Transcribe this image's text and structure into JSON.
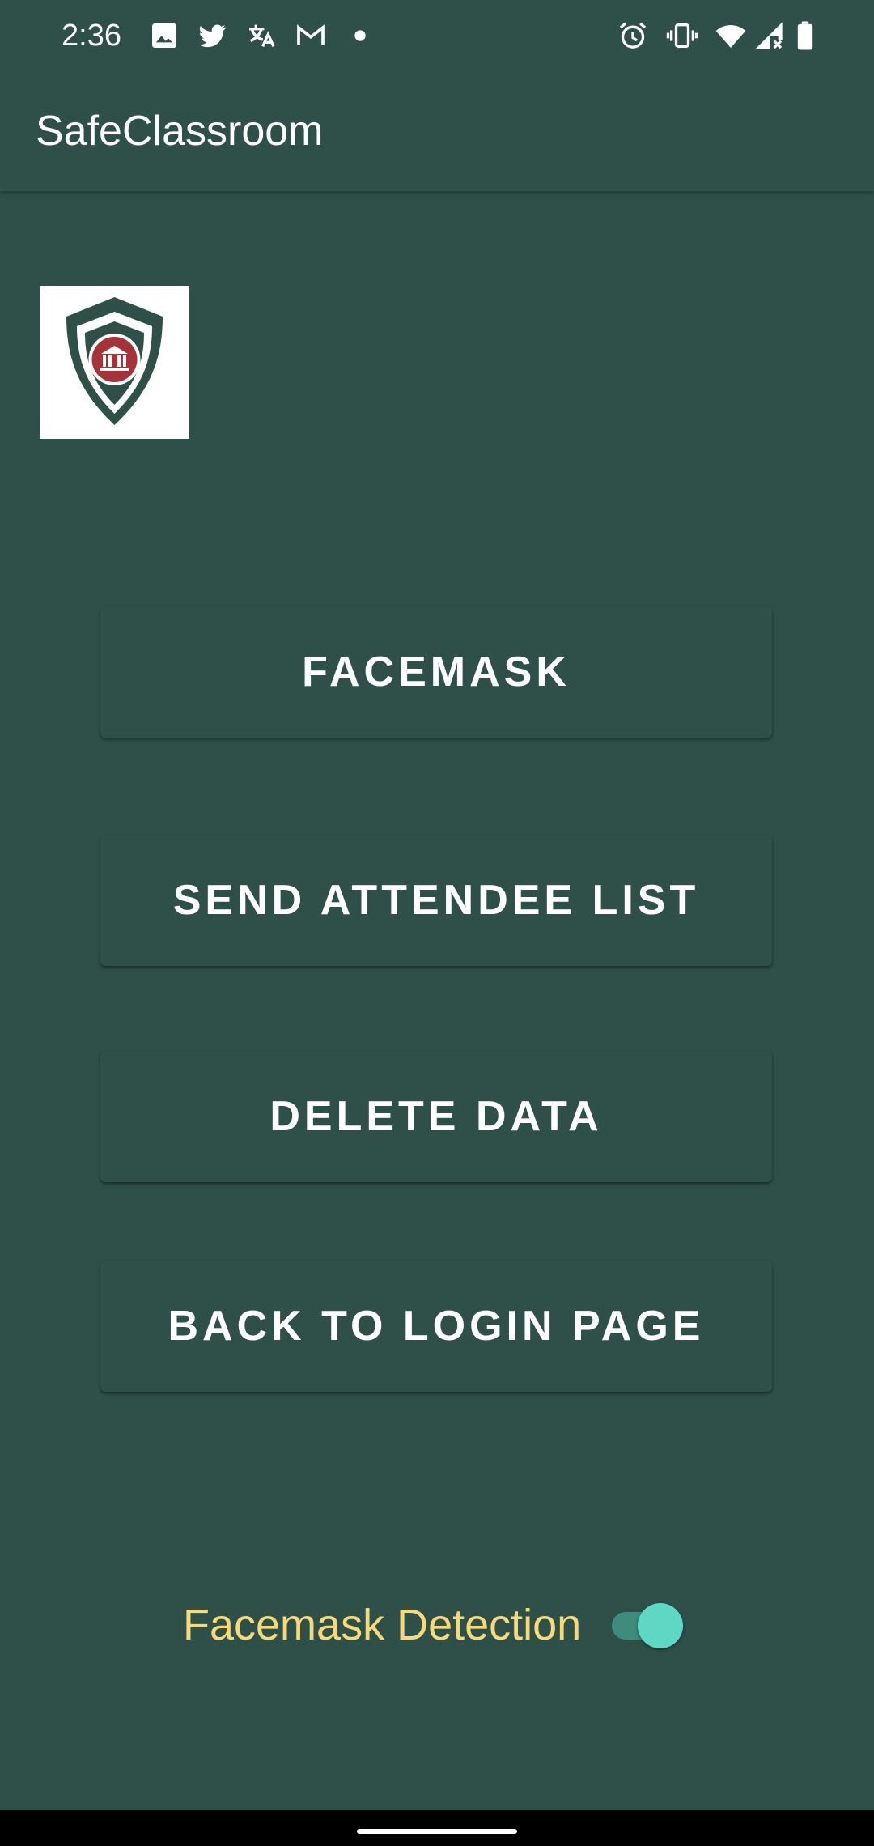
{
  "status_bar": {
    "time": "2:36",
    "left_icons": [
      "image-icon",
      "twitter-icon",
      "translate-icon",
      "gmail-icon",
      "dot-icon"
    ],
    "right_icons": [
      "alarm-icon",
      "vibrate-icon",
      "wifi-icon",
      "signal-icon",
      "battery-icon"
    ]
  },
  "app_bar": {
    "title": "SafeClassroom"
  },
  "logo": {
    "icon": "shield-logo"
  },
  "buttons": {
    "facemask": "FACEMASK",
    "send_attendee_list": "SEND ATTENDEE LIST",
    "delete_data": "DELETE DATA",
    "back_to_login": "BACK TO LOGIN PAGE"
  },
  "toggle": {
    "label": "Facemask Detection",
    "checked": true
  },
  "colors": {
    "background": "#2E5048",
    "toggle_label": "#F7D97A",
    "switch_thumb": "#5ED8C4",
    "switch_track": "#3E8C7C"
  }
}
